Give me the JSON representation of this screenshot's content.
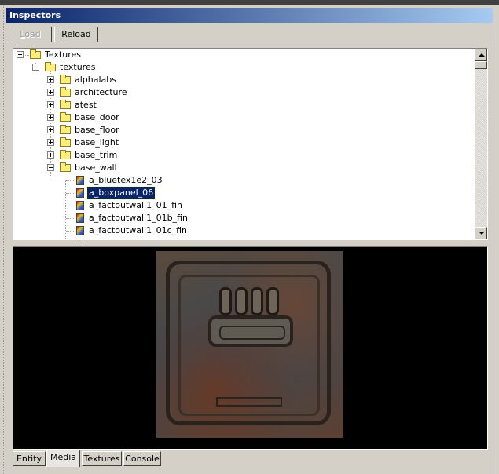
{
  "window": {
    "title": "Inspectors"
  },
  "toolbar": {
    "load_label": "Load",
    "reload_label": "Reload"
  },
  "tree": {
    "root": "Textures",
    "textures": "textures",
    "folders": [
      "alphalabs",
      "architecture",
      "atest",
      "base_door",
      "base_floor",
      "base_light",
      "base_trim",
      "base_wall"
    ],
    "files": [
      "a_bluetex1e2_03",
      "a_boxpanel_06",
      "a_factoutwall1_01_fin",
      "a_factoutwall1_01b_fin",
      "a_factoutwall1_01c_fin"
    ],
    "selected": "a_boxpanel_06"
  },
  "tabs": [
    "Entity",
    "Media",
    "Textures",
    "Console"
  ],
  "active_tab": "Media",
  "colors": {
    "title_start": "#0a246a",
    "title_end": "#a6caf0",
    "selection": "#0a246a",
    "face": "#d4d0c8"
  }
}
